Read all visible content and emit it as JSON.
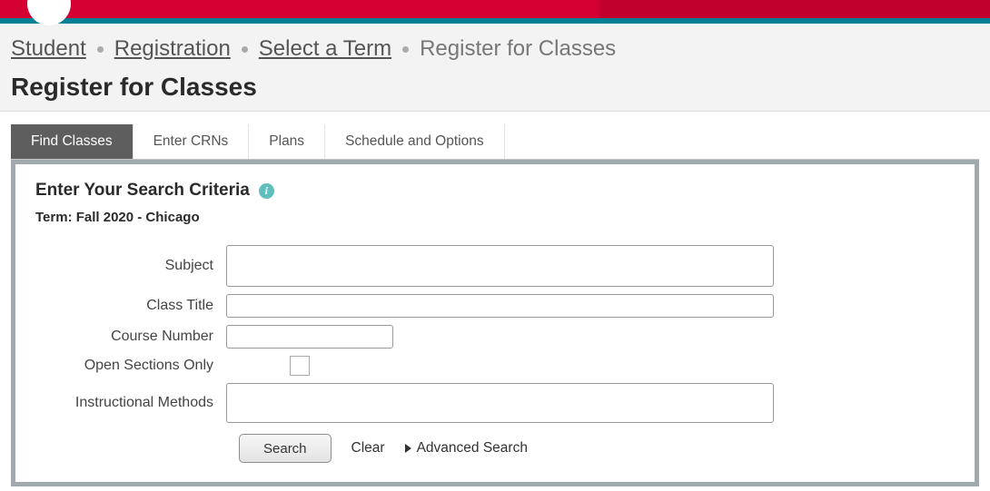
{
  "breadcrumb": {
    "items": [
      "Student",
      "Registration",
      "Select a Term"
    ],
    "current": "Register for Classes"
  },
  "page_title": "Register for Classes",
  "tabs": [
    {
      "label": "Find Classes",
      "active": true
    },
    {
      "label": "Enter CRNs",
      "active": false
    },
    {
      "label": "Plans",
      "active": false
    },
    {
      "label": "Schedule and Options",
      "active": false
    }
  ],
  "search": {
    "heading": "Enter Your Search Criteria",
    "term_label": "Term: Fall 2020 - Chicago",
    "labels": {
      "subject": "Subject",
      "class_title": "Class Title",
      "course_number": "Course Number",
      "open_only": "Open Sections Only",
      "instructional": "Instructional Methods"
    },
    "values": {
      "subject": "",
      "class_title": "",
      "course_number": "",
      "open_only": false,
      "instructional": ""
    },
    "buttons": {
      "search": "Search",
      "clear": "Clear",
      "advanced": "Advanced Search"
    }
  }
}
